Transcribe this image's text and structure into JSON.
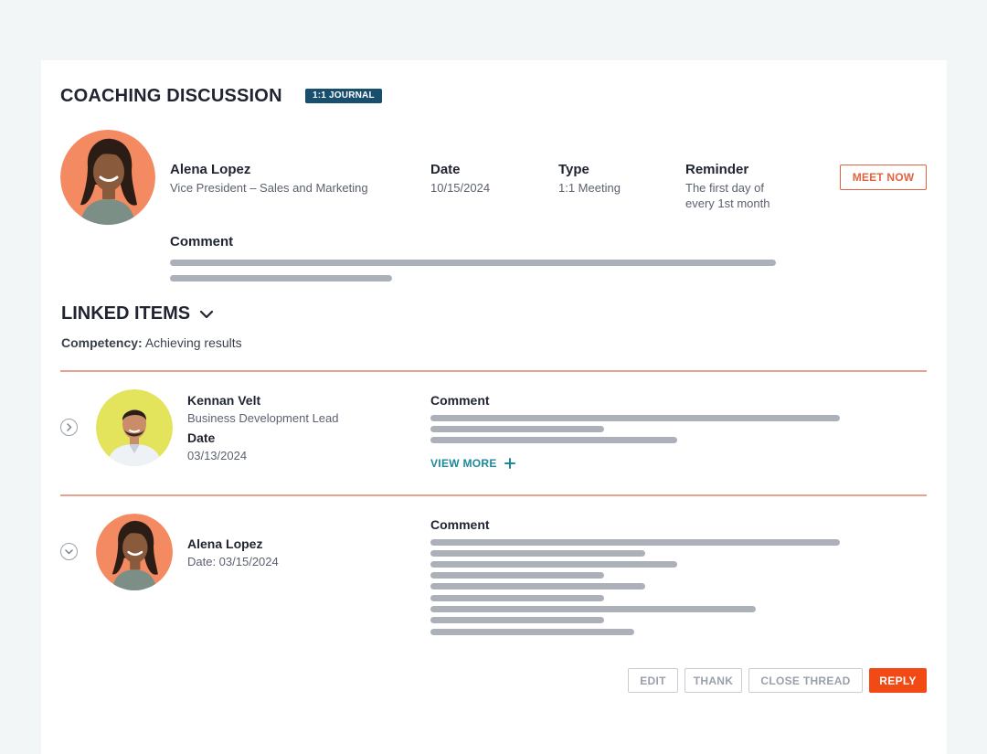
{
  "header": {
    "title": "COACHING DISCUSSION",
    "tag": "1:1 JOURNAL"
  },
  "discussion": {
    "person_name": "Alena Lopez",
    "person_role": "Vice President – Sales and Marketing",
    "date_label": "Date",
    "date_value": "10/15/2024",
    "type_label": "Type",
    "type_value": "1:1 Meeting",
    "reminder_label": "Reminder",
    "reminder_line1": "The first day of",
    "reminder_line2": "every 1st month",
    "meet_now_label": "MEET NOW",
    "comment_label": "Comment"
  },
  "linked": {
    "title": "LINKED ITEMS",
    "competency_label": "Competency:",
    "competency_value": "Achieving results",
    "items": [
      {
        "name": "Kennan Velt",
        "role": "Business Development Lead",
        "date_label": "Date",
        "date_value": "03/13/2024",
        "comment_label": "Comment",
        "view_more_label": "VIEW MORE"
      },
      {
        "name": "Alena Lopez",
        "date_line": "Date: 03/15/2024",
        "comment_label": "Comment"
      }
    ]
  },
  "actions": {
    "edit": "EDIT",
    "thank": "THANK",
    "close_thread": "CLOSE THREAD",
    "reply": "REPLY"
  },
  "colors": {
    "accent_orange": "#f14a14",
    "teal": "#1c8a9a",
    "tag_blue": "#184e6e"
  }
}
